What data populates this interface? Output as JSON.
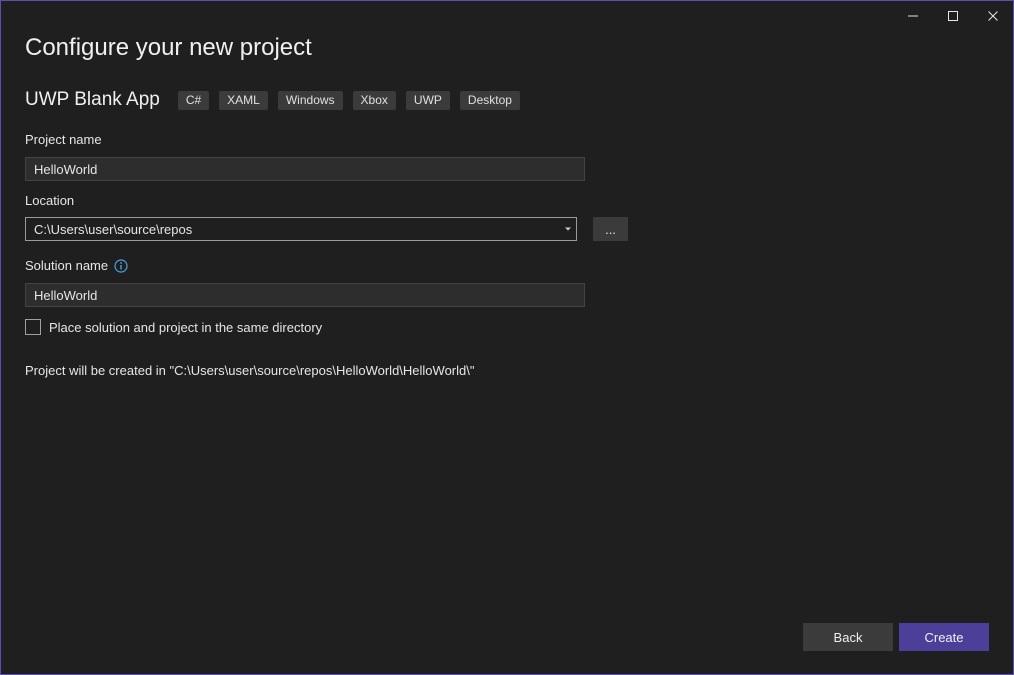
{
  "window": {
    "caption": {
      "minimize_icon": "minimize-icon",
      "maximize_icon": "maximize-icon",
      "close_icon": "close-icon"
    },
    "accent_color": "#5b4fb2"
  },
  "page_title": "Configure your new project",
  "template": {
    "name": "UWP Blank App",
    "tags": [
      "C#",
      "XAML",
      "Windows",
      "Xbox",
      "UWP",
      "Desktop"
    ]
  },
  "project_name": {
    "label": "Project name",
    "value": "HelloWorld"
  },
  "location": {
    "label": "Location",
    "value": "C:\\Users\\user\\source\\repos",
    "browse_label": "..."
  },
  "solution_name": {
    "label": "Solution name",
    "info_icon": "info-icon",
    "value": "HelloWorld"
  },
  "same_directory": {
    "label": "Place solution and project in the same directory",
    "checked": false
  },
  "created_path_text": "Project will be created in \"C:\\Users\\user\\source\\repos\\HelloWorld\\HelloWorld\\\"",
  "footer": {
    "back_label": "Back",
    "create_label": "Create",
    "create_color": "#4b3f99"
  }
}
